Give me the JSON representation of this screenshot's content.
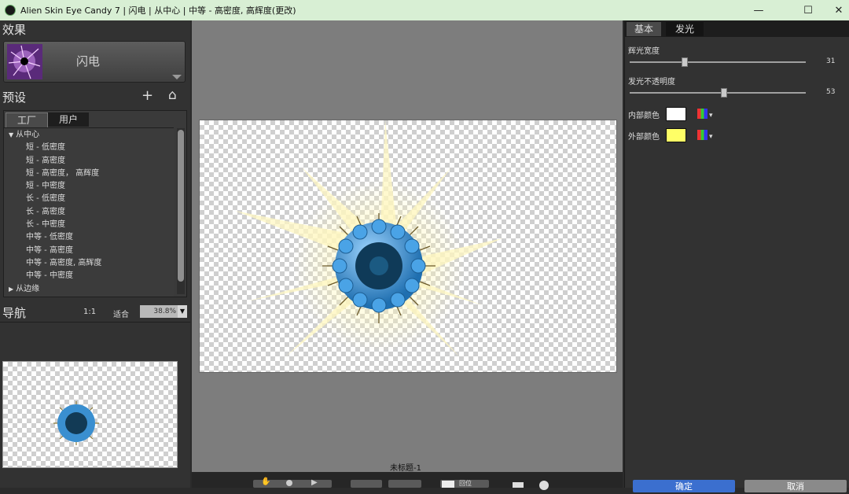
{
  "window": {
    "title": "Alien Skin Eye Candy 7 | 闪电 | 从中心 | 中等 - 高密度, 高辉度(更改)",
    "minimize": "—",
    "maximize": "☐",
    "close": "✕"
  },
  "left": {
    "effects_heading": "效果",
    "current_effect": "闪电",
    "presets_heading": "预设",
    "add_icon": "+",
    "home_icon": "⌂",
    "tabs": [
      "工厂",
      "用户"
    ],
    "tree": [
      {
        "label": "从中心",
        "arrow": "▼",
        "level": 0
      },
      {
        "label": "短 - 低密度",
        "level": 1
      },
      {
        "label": "短 - 高密度",
        "level": 1
      },
      {
        "label": "短 - 高密度， 高辉度",
        "level": 1
      },
      {
        "label": "短 - 中密度",
        "level": 1
      },
      {
        "label": "长 - 低密度",
        "level": 1
      },
      {
        "label": "长 - 高密度",
        "level": 1
      },
      {
        "label": "长 - 中密度",
        "level": 1
      },
      {
        "label": "中等 - 低密度",
        "level": 1
      },
      {
        "label": "中等 - 高密度",
        "level": 1
      },
      {
        "label": "中等 - 高密度, 高辉度",
        "level": 1
      },
      {
        "label": "中等 - 中密度",
        "level": 1
      },
      {
        "label": "从边缘",
        "arrow": "▶",
        "level": 0
      }
    ],
    "nav_heading": "导航",
    "zoom_1to1": "1:1",
    "zoom_fit": "适合",
    "zoom_value": "38.8%",
    "zoom_arrow": "▼"
  },
  "canvas": {
    "document_name": "未标题-1"
  },
  "right": {
    "tabs": [
      "基本",
      "发光"
    ],
    "active_tab": "发光",
    "glow_width_label": "辉光宽度",
    "glow_width_value": "31",
    "glow_width_level": 0.31,
    "glow_opacity_label": "发光不透明度",
    "glow_opacity_value": "53",
    "glow_opacity_level": 0.53,
    "inner_color_label": "内部颜色",
    "inner_color": "#ffffff",
    "outer_color_label": "外部颜色",
    "outer_color": "#ffff66",
    "ok_label": "确定",
    "cancel_label": "取消",
    "color_arrow": "▾"
  },
  "bottom": {
    "compare_label": "回位"
  }
}
